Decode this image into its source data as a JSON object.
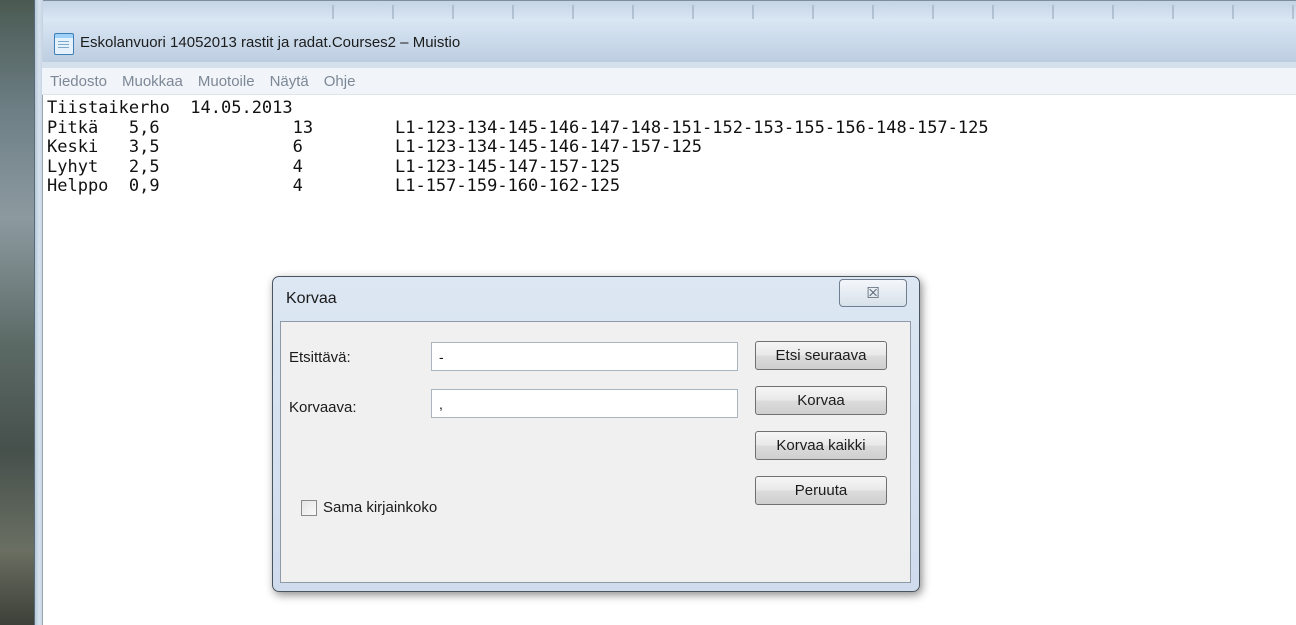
{
  "window": {
    "title": "Eskolanvuori 14052013 rastit ja radat.Courses2 – Muistio"
  },
  "menu": [
    {
      "label": "Tiedosto"
    },
    {
      "label": "Muokkaa"
    },
    {
      "label": "Muotoile"
    },
    {
      "label": "Näytä"
    },
    {
      "label": "Ohje"
    }
  ],
  "editor": {
    "text": "Tiistaikerho  14.05.2013\nPitkä   5,6             13        L1-123-134-145-146-147-148-151-152-153-155-156-148-157-125\nKeski   3,5             6         L1-123-134-145-146-147-157-125\nLyhyt   2,5             4         L1-123-145-147-157-125\nHelppo  0,9             4         L1-157-159-160-162-125"
  },
  "dialog": {
    "title": "Korvaa",
    "close_symbol": "☒",
    "find_label": "Etsittävä:",
    "find_value": "-",
    "replace_label": "Korvaava:",
    "replace_value": ",",
    "buttons": {
      "find_next": "Etsi seuraava",
      "replace": "Korvaa",
      "replace_all": "Korvaa kaikki",
      "cancel": "Peruuta"
    },
    "match_case_label": "Sama kirjainkoko",
    "match_case_checked": false
  }
}
